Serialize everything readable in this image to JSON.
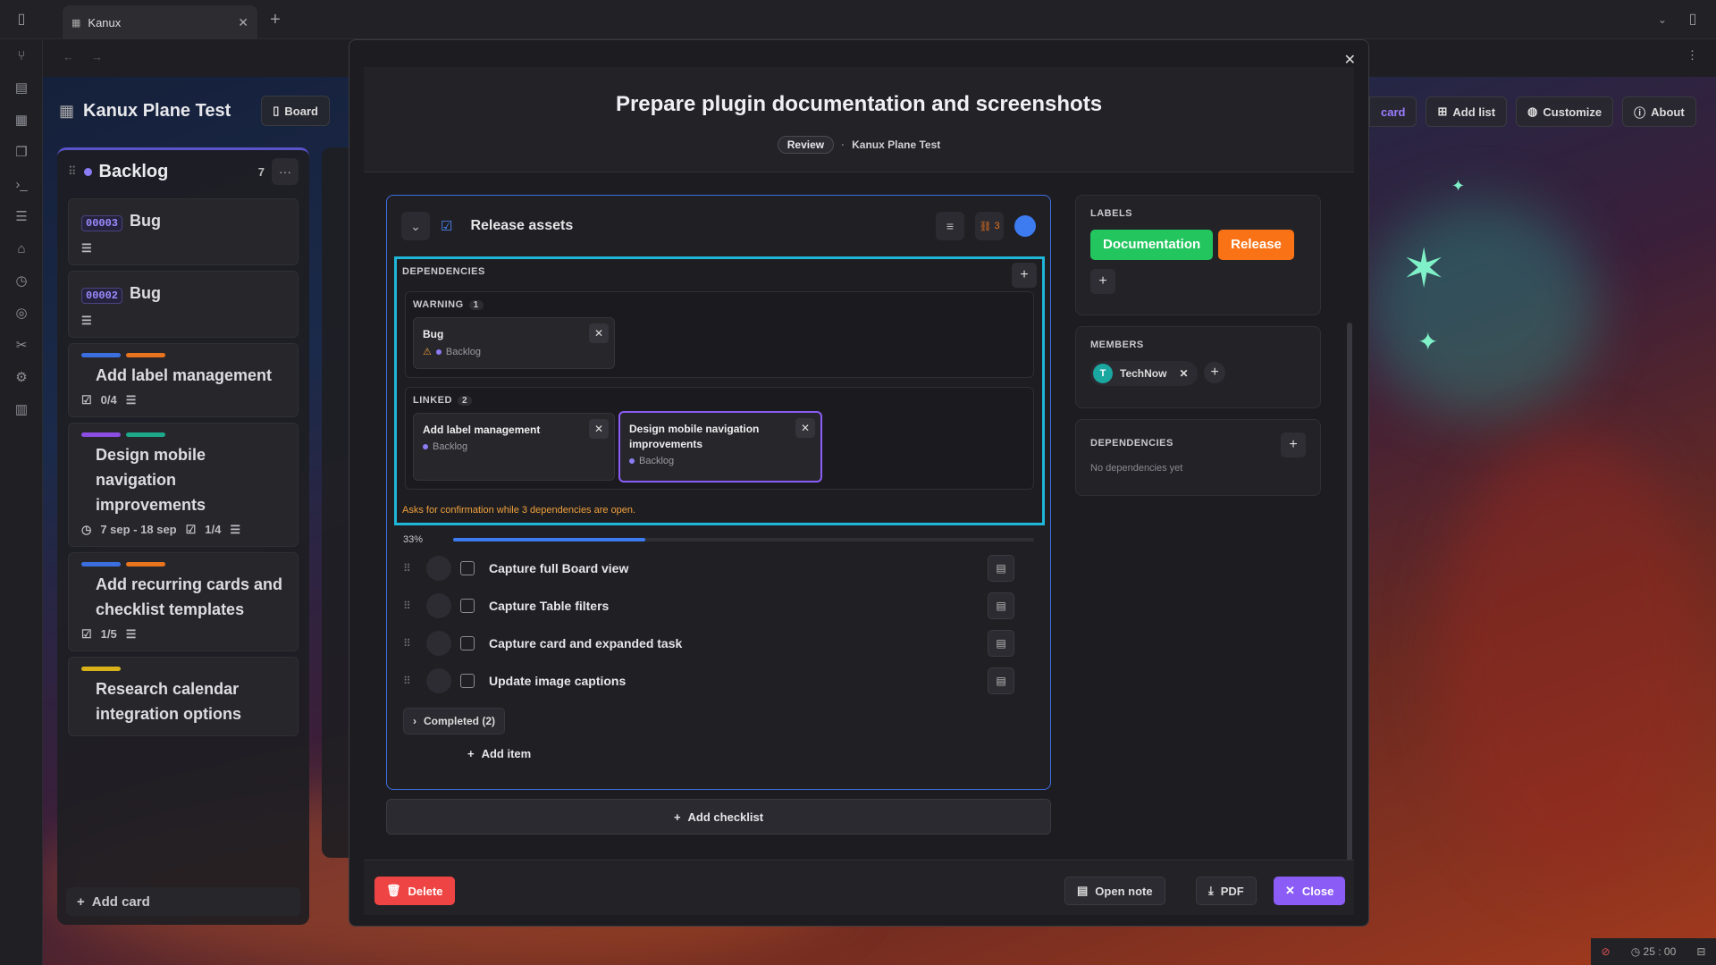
{
  "app": {
    "tab_title": "Kanux",
    "new_tab": "+"
  },
  "board": {
    "title": "Kanux Plane Test",
    "view_button": "Board",
    "right_buttons": [
      "card",
      "Add list",
      "Customize",
      "About"
    ]
  },
  "column": {
    "name": "Backlog",
    "count": "7",
    "menu": "···",
    "cards": [
      {
        "id": "00003",
        "title": "Bug"
      },
      {
        "id": "00002",
        "title": "Bug"
      },
      {
        "title": "Add label management",
        "meta": "0/4",
        "bars": [
          "#3b6fe0",
          "#e8741e"
        ]
      },
      {
        "title": "Design mobile navigation improvements",
        "dates": "7 sep - 18 sep",
        "meta": "1/4",
        "bars": [
          "#8b4ee0",
          "#1ea88a"
        ]
      },
      {
        "title": "Add recurring cards and checklist templates",
        "meta": "1/5",
        "bars": [
          "#3b6fe0",
          "#e8741e"
        ]
      },
      {
        "title": "Research calendar integration options",
        "bars": [
          "#d9b21a"
        ]
      }
    ],
    "add_card": "Add card"
  },
  "modal": {
    "title": "Prepare plugin documentation and screenshots",
    "status": "Review",
    "board": "Kanux Plane Test",
    "checklist": {
      "title": "Release assets",
      "link_count": "3",
      "dependencies_label": "DEPENDENCIES",
      "warning": {
        "label": "WARNING",
        "count": "1",
        "cards": [
          {
            "name": "Bug",
            "list": "Backlog"
          }
        ]
      },
      "linked": {
        "label": "LINKED",
        "count": "2",
        "cards": [
          {
            "name": "Add label management",
            "list": "Backlog"
          },
          {
            "name": "Design mobile navigation improvements",
            "list": "Backlog"
          }
        ]
      },
      "warning_message": "Asks for confirmation while 3 dependencies are open.",
      "progress_label": "33%",
      "progress": 0.33,
      "items": [
        "Capture full Board view",
        "Capture Table filters",
        "Capture card and expanded task",
        "Update image captions"
      ],
      "completed": "Completed (2)",
      "add_item": "Add item"
    },
    "add_checklist": "Add checklist",
    "labels": {
      "heading": "LABELS",
      "items": [
        {
          "text": "Documentation",
          "color": "#22c55e"
        },
        {
          "text": "Release",
          "color": "#f97316"
        }
      ]
    },
    "members": {
      "heading": "MEMBERS",
      "items": [
        {
          "initial": "T",
          "name": "TechNow"
        }
      ]
    },
    "dependencies": {
      "heading": "DEPENDENCIES",
      "empty": "No dependencies yet"
    },
    "footer": {
      "delete": "Delete",
      "open_note": "Open note",
      "pdf": "PDF",
      "close": "Close"
    }
  },
  "status": {
    "timer": "25 : 00"
  }
}
